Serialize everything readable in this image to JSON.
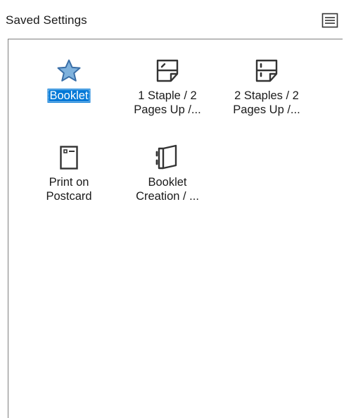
{
  "header": {
    "title": "Saved Settings",
    "menu_icon": "list-view-icon"
  },
  "items": [
    {
      "label": "Booklet",
      "icon": "star-icon",
      "selected": true
    },
    {
      "label": "1 Staple / 2\nPages Up /...",
      "icon": "one-staple-icon",
      "selected": false
    },
    {
      "label": "2 Staples / 2\nPages Up /...",
      "icon": "two-staples-icon",
      "selected": false
    },
    {
      "label": "Print on\nPostcard",
      "icon": "postcard-icon",
      "selected": false
    },
    {
      "label": "Booklet\nCreation / ...",
      "icon": "booklet-creation-icon",
      "selected": false
    }
  ],
  "colors": {
    "selection": "#0078d7",
    "star_fill": "#7fb2dd",
    "star_stroke": "#3a6fa8",
    "icon_stroke": "#333333"
  }
}
